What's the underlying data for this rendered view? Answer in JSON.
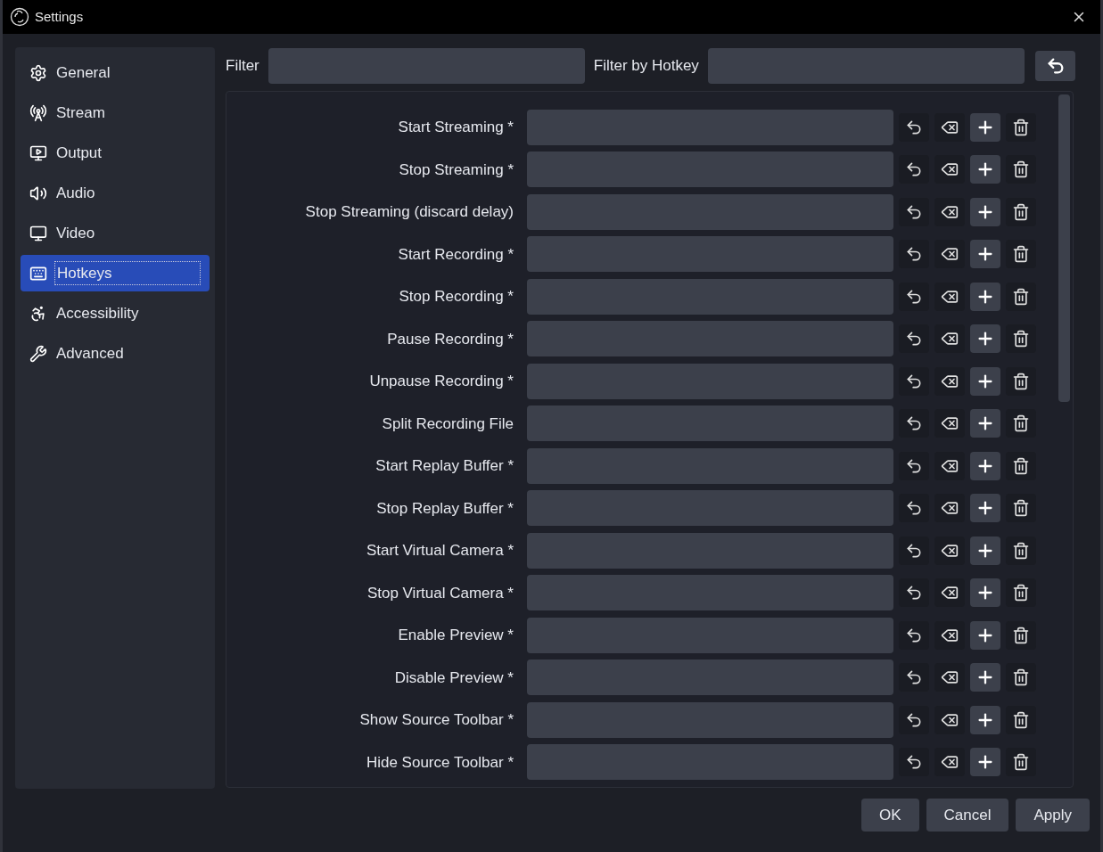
{
  "window": {
    "title": "Settings"
  },
  "sidebar": {
    "items": [
      {
        "kind": "general",
        "label": "General",
        "selected": false
      },
      {
        "kind": "stream",
        "label": "Stream",
        "selected": false
      },
      {
        "kind": "output",
        "label": "Output",
        "selected": false
      },
      {
        "kind": "audio",
        "label": "Audio",
        "selected": false
      },
      {
        "kind": "video",
        "label": "Video",
        "selected": false
      },
      {
        "kind": "hotkeys",
        "label": "Hotkeys",
        "selected": true
      },
      {
        "kind": "accessibility",
        "label": "Accessibility",
        "selected": false
      },
      {
        "kind": "advanced",
        "label": "Advanced",
        "selected": false
      }
    ]
  },
  "filter": {
    "label": "Filter",
    "hotkey_label": "Filter by Hotkey"
  },
  "hotkeys": [
    {
      "label": "Start Streaming *"
    },
    {
      "label": "Stop Streaming *"
    },
    {
      "label": "Stop Streaming (discard delay)"
    },
    {
      "label": "Start Recording *"
    },
    {
      "label": "Stop Recording *"
    },
    {
      "label": "Pause Recording *"
    },
    {
      "label": "Unpause Recording *"
    },
    {
      "label": "Split Recording File"
    },
    {
      "label": "Start Replay Buffer *"
    },
    {
      "label": "Stop Replay Buffer *"
    },
    {
      "label": "Start Virtual Camera *"
    },
    {
      "label": "Stop Virtual Camera *"
    },
    {
      "label": "Enable Preview *"
    },
    {
      "label": "Disable Preview *"
    },
    {
      "label": "Show Source Toolbar *"
    },
    {
      "label": "Hide Source Toolbar *"
    }
  ],
  "buttons": [
    "OK",
    "Cancel",
    "Apply"
  ]
}
